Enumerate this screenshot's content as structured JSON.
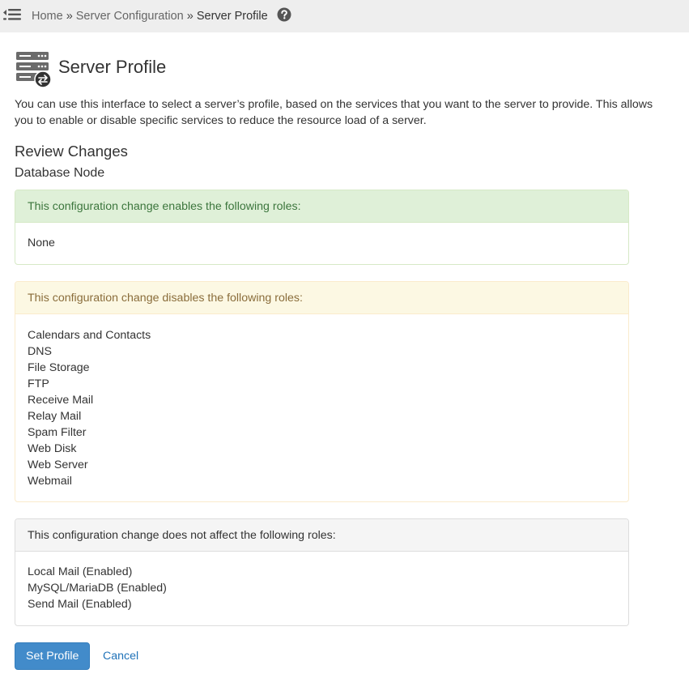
{
  "breadcrumb": {
    "home": "Home",
    "separator": "»",
    "section": "Server Configuration",
    "current": "Server Profile"
  },
  "icons": {
    "menu": "menu-toggle-icon",
    "help": "help-icon",
    "page": "server-profile-icon"
  },
  "page": {
    "title": "Server Profile",
    "intro": "You can use this interface to select a server’s profile, based on the services that you want to the server to provide. This allows you to enable or disable specific services to reduce the resource load of a server.",
    "review_title": "Review Changes",
    "profile_name": "Database Node"
  },
  "panels": {
    "enables": {
      "heading": "This configuration change enables the following roles:",
      "items": [
        "None"
      ]
    },
    "disables": {
      "heading": "This configuration change disables the following roles:",
      "items": [
        "Calendars and Contacts",
        "DNS",
        "File Storage",
        "FTP",
        "Receive Mail",
        "Relay Mail",
        "Spam Filter",
        "Web Disk",
        "Web Server",
        "Webmail"
      ]
    },
    "unaffected": {
      "heading": "This configuration change does not affect the following roles:",
      "items": [
        "Local Mail (Enabled)",
        "MySQL/MariaDB (Enabled)",
        "Send Mail (Enabled)"
      ]
    }
  },
  "actions": {
    "submit_label": "Set Profile",
    "cancel_label": "Cancel"
  },
  "colors": {
    "primary": "#428bca",
    "link": "#1f72b8",
    "success_bg": "#dff0d8",
    "success_text": "#3c763d",
    "warning_bg": "#fcf8e3",
    "warning_text": "#8a6d3b"
  }
}
